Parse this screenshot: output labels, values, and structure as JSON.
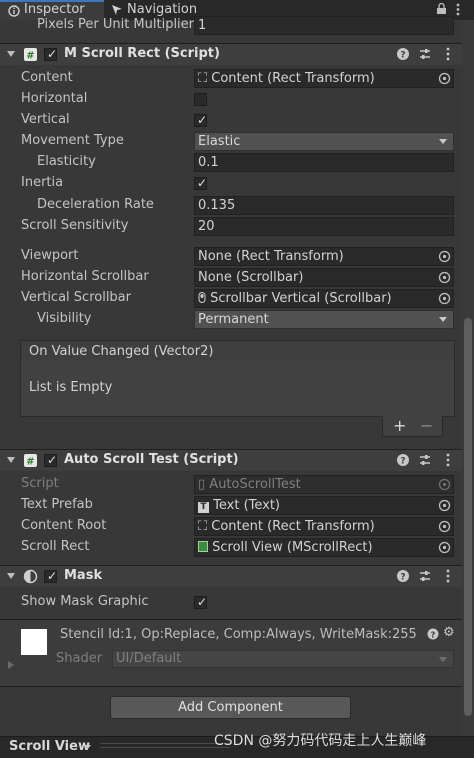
{
  "tabs": [
    {
      "label": "Inspector",
      "icon": "info-icon",
      "active": true
    },
    {
      "label": "Navigation",
      "icon": "navigation-icon",
      "active": false
    }
  ],
  "top_row": {
    "label": "Pixels Per Unit Multiplier",
    "value": "1"
  },
  "scroll_rect": {
    "title": "M Scroll Rect (Script)",
    "content": {
      "label": "Content",
      "value": "Content (Rect Transform)"
    },
    "horizontal": {
      "label": "Horizontal",
      "checked": false
    },
    "vertical": {
      "label": "Vertical",
      "checked": true
    },
    "movement_type": {
      "label": "Movement Type",
      "value": "Elastic"
    },
    "elasticity": {
      "label": "Elasticity",
      "value": "0.1"
    },
    "inertia": {
      "label": "Inertia",
      "checked": true
    },
    "deceleration_rate": {
      "label": "Deceleration Rate",
      "value": "0.135"
    },
    "scroll_sensitivity": {
      "label": "Scroll Sensitivity",
      "value": "20"
    },
    "viewport": {
      "label": "Viewport",
      "value": "None (Rect Transform)"
    },
    "horizontal_scrollbar": {
      "label": "Horizontal Scrollbar",
      "value": "None (Scrollbar)"
    },
    "vertical_scrollbar": {
      "label": "Vertical Scrollbar",
      "value": "Scrollbar Vertical (Scrollbar)"
    },
    "visibility": {
      "label": "Visibility",
      "value": "Permanent"
    },
    "event": {
      "title": "On Value Changed (Vector2)",
      "empty_text": "List is Empty",
      "add": "+",
      "remove": "−"
    }
  },
  "auto_scroll": {
    "title": "Auto Scroll Test (Script)",
    "script": {
      "label": "Script",
      "value": "AutoScrollTest"
    },
    "text_prefab": {
      "label": "Text Prefab",
      "value": "Text (Text)"
    },
    "content_root": {
      "label": "Content Root",
      "value": "Content (Rect Transform)"
    },
    "scroll_rect": {
      "label": "Scroll Rect",
      "value": "Scroll View (MScrollRect)"
    }
  },
  "mask": {
    "title": "Mask",
    "show_mask_graphic": {
      "label": "Show Mask Graphic",
      "checked": true
    }
  },
  "material": {
    "name": "Stencil Id:1, Op:Replace, Comp:Always, WriteMask:255",
    "shader_label": "Shader",
    "shader_value": "UI/Default"
  },
  "add_component": "Add Component",
  "footer": {
    "title": "Scroll View",
    "watermark": "CSDN @努力码代码走上人生巅峰"
  },
  "colors": {
    "background": "#383838",
    "accent": "#3a79bb",
    "field": "#2a2a2a"
  }
}
